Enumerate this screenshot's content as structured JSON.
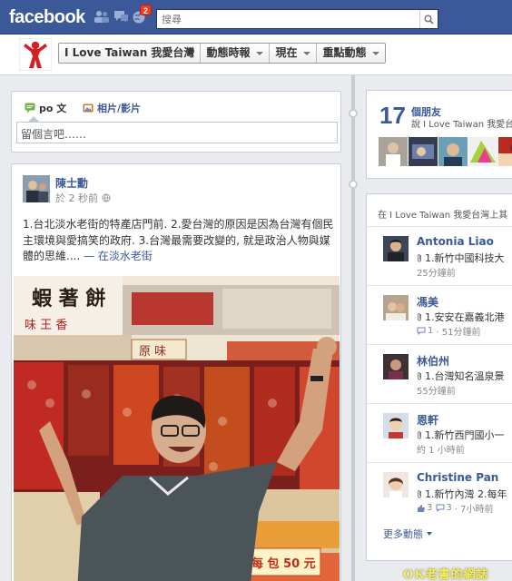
{
  "topbar": {
    "logo": "facebook",
    "notification_count": "2",
    "search_placeholder": "搜尋"
  },
  "page": {
    "menu": [
      {
        "label": "I Love Taiwan 我愛台灣",
        "caret": false
      },
      {
        "label": "動態時報",
        "caret": true
      },
      {
        "label": "現在",
        "caret": true
      },
      {
        "label": "重點動態",
        "caret": true
      }
    ]
  },
  "composer": {
    "tab_post": "po 文",
    "tab_photo": "相片/影片",
    "placeholder": "留個言吧……"
  },
  "post": {
    "author": "陳士勳",
    "time": "於 2 秒前",
    "text": "1.台北淡水老街的特產店門前. 2.愛台灣的原因是因為台灣有個民主環境與愛搞笑的政府. 3.台灣最需要改變的, 就是政治人物與媒體的思維....",
    "location": " — 在淡水老街",
    "photo_signs": {
      "sign_1": "蝦 著 餅",
      "sign_2": "味 王 香",
      "sign_3": "原 味",
      "sign_4": "每 包 50 元"
    }
  },
  "friends": {
    "count": "17",
    "label": "個朋友",
    "subtitle": "說 I Love Taiwan 我愛台"
  },
  "activity": {
    "header": "在 I Love Taiwan 我愛台灣上其",
    "items": [
      {
        "name": "Antonia Liao",
        "text": "1.新竹中國科技大",
        "meta": "25分鐘前",
        "likes": "",
        "comments": ""
      },
      {
        "name": "馮美",
        "text": "1.安安在嘉義北港",
        "meta": "· 51分鐘前",
        "likes": "",
        "comments": "1"
      },
      {
        "name": "林伯州",
        "text": "1.台灣知名溫泉景",
        "meta": "55分鐘前",
        "likes": "",
        "comments": ""
      },
      {
        "name": "恩軒",
        "text": "1.新竹西門國小一",
        "meta": "約 1 小時前",
        "likes": "",
        "comments": ""
      },
      {
        "name": "Christine Pan",
        "text": "1.新竹內灣 2.每年",
        "meta": "· 7小時前",
        "likes": "3",
        "comments": "3"
      }
    ],
    "more": "更多動態"
  },
  "watermark": "OK老書的網誌",
  "colors": {
    "brand_blue": "#3b5998",
    "background": "#e9ebee",
    "badge_red": "#f03d25"
  }
}
